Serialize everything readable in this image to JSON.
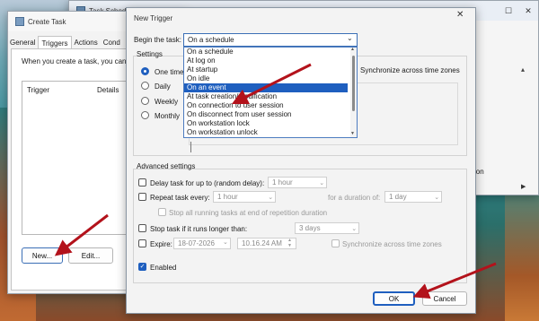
{
  "task_scheduler": {
    "title": "Task Schedule",
    "right_pane_label": "ion"
  },
  "create_task": {
    "title": "Create Task",
    "tabs": [
      "General",
      "Triggers",
      "Actions",
      "Cond"
    ],
    "description": "When you create a task, you can s",
    "columns": {
      "trigger": "Trigger",
      "details": "Details"
    },
    "buttons": {
      "new": "New...",
      "edit": "Edit..."
    }
  },
  "new_trigger": {
    "title": "New Trigger",
    "close": "✕",
    "begin_label": "Begin the task:",
    "begin_value": "On a schedule",
    "settings_label": "Settings",
    "schedule_options": [
      "One time",
      "Daily",
      "Weekly",
      "Monthly"
    ],
    "sync_label": "Synchronize across time zones",
    "dropdown_options": [
      "On a schedule",
      "At log on",
      "At startup",
      "On idle",
      "On an event",
      "At task creation/modification",
      "On connection to user session",
      "On disconnect from user session",
      "On workstation lock",
      "On workstation unlock"
    ],
    "dropdown_selected_index": 4,
    "advanced": {
      "label": "Advanced settings",
      "delay_label": "Delay task for up to (random delay):",
      "delay_value": "1 hour",
      "repeat_label": "Repeat task every:",
      "repeat_value": "1 hour",
      "duration_label": "for a duration of:",
      "duration_value": "1 day",
      "stop_all_label": "Stop all running tasks at end of repetition duration",
      "stop_if_label": "Stop task if it runs longer than:",
      "stop_if_value": "3 days",
      "expire_label": "Expire:",
      "expire_date": "18-07-2026",
      "expire_time": "10.16.24 AM",
      "expire_sync_label": "Synchronize across time zones",
      "enabled_label": "Enabled",
      "enabled": true
    },
    "buttons": {
      "ok": "OK",
      "cancel": "Cancel"
    }
  },
  "colors": {
    "accent": "#1f5fbf",
    "arrow": "#b3121b"
  }
}
